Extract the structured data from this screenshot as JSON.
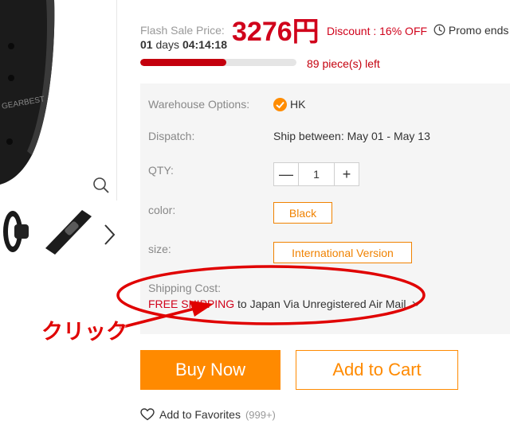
{
  "flash_sale": {
    "label": "Flash Sale Price:",
    "price": "3276円",
    "discount": "Discount : 16% OFF",
    "promo": "Promo ends",
    "countdown_days": "01",
    "countdown_days_label": "days",
    "countdown_time": "04:14:18",
    "progress_fraction": 0.55,
    "pieces_left": "89 piece(s) left"
  },
  "options": {
    "warehouse_label": "Warehouse Options:",
    "warehouse_value": "HK",
    "dispatch_label": "Dispatch:",
    "dispatch_value": "Ship between: May 01 - May 13",
    "qty_label": "QTY:",
    "qty_value": "1",
    "qty_minus": "—",
    "qty_plus": "+",
    "color_label": "color:",
    "color_value": "Black",
    "size_label": "size:",
    "size_value": "International Version",
    "shipping_label": "Shipping Cost:",
    "shipping_free": "FREE SHIPPING",
    "shipping_rest": " to Japan Via Unregistered Air Mail"
  },
  "actions": {
    "buy_now": "Buy Now",
    "add_to_cart": "Add to Cart",
    "add_to_favorites": "Add to Favorites",
    "favorites_count": "(999+)"
  },
  "gallery": {
    "watermark": "GEARBEST"
  },
  "annotation": {
    "text": "クリック"
  },
  "colors": {
    "price_red": "#d0021b",
    "accent_orange": "#ff8a00",
    "annotation_red": "#e00000"
  }
}
